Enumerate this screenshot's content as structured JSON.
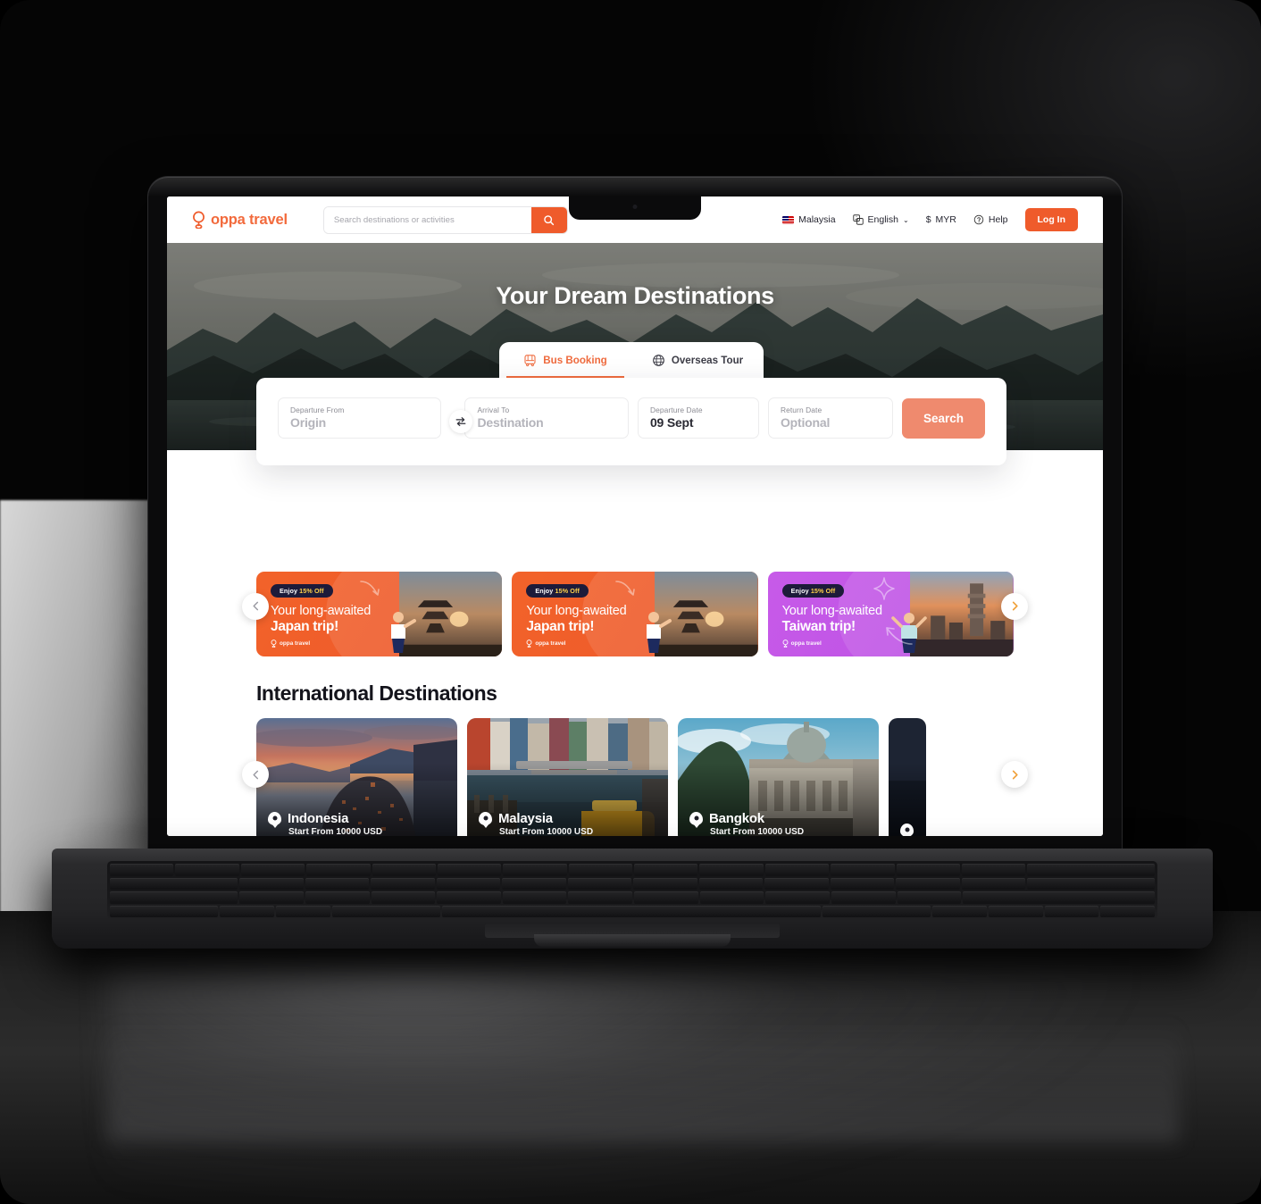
{
  "header": {
    "logo_text": "oppa travel",
    "logo_icon": "balloon-pin-icon",
    "search_placeholder": "Search destinations or activities",
    "search_value": "",
    "search_icon": "search-icon",
    "country": "Malaysia",
    "language": "English",
    "language_caret": "⌄",
    "currency": "MYR",
    "currency_symbol": "$",
    "help": "Help",
    "help_icon": "question-circle-icon",
    "login": "Log In"
  },
  "hero": {
    "title": "Your Dream Destinations"
  },
  "search_card": {
    "tabs": [
      {
        "label": "Bus Booking",
        "icon": "bus-icon",
        "active": true
      },
      {
        "label": "Overseas Tour",
        "icon": "globe-icon",
        "active": false
      }
    ],
    "fields": [
      {
        "name": "departure-from",
        "label": "Departure From",
        "value": "Origin",
        "is_placeholder": true
      },
      {
        "name": "arrival-to",
        "label": "Arrival To",
        "value": "Destination",
        "is_placeholder": true
      },
      {
        "name": "departure-date",
        "label": "Departure Date",
        "value": "09 Sept",
        "is_placeholder": false
      },
      {
        "name": "return-date",
        "label": "Return Date",
        "value": "Optional",
        "is_placeholder": true
      }
    ],
    "swap_icon": "swap-arrows-icon",
    "search_button": "Search"
  },
  "promos": [
    {
      "badge_prefix": "Enjoy ",
      "badge_value": "15% Off",
      "line1": "Your long-awaited",
      "line2": "Japan trip!",
      "brand": "oppa travel",
      "color": "#ef5b2b",
      "theme": "orange"
    },
    {
      "badge_prefix": "Enjoy ",
      "badge_value": "15% Off",
      "line1": "Your long-awaited",
      "line2": "Japan trip!",
      "brand": "oppa travel",
      "color": "#ef5b2b",
      "theme": "orange"
    },
    {
      "badge_prefix": "Enjoy ",
      "badge_value": "15% Off",
      "line1": "Your long-awaited",
      "line2": "Taiwan trip!",
      "brand": "oppa travel",
      "color": "#c055e6",
      "theme": "purple"
    }
  ],
  "carousel": {
    "prev_icon": "chevron-left-icon",
    "next_icon": "chevron-right-icon"
  },
  "section": {
    "title": "International Destinations"
  },
  "destinations": [
    {
      "name": "Indonesia",
      "subtitle": "Start From 10000 USD",
      "pin_icon": "location-pin-icon"
    },
    {
      "name": "Malaysia",
      "subtitle": "Start From 10000 USD",
      "pin_icon": "location-pin-icon"
    },
    {
      "name": "Bangkok",
      "subtitle": "Start From 10000 USD",
      "pin_icon": "location-pin-icon"
    }
  ],
  "colors": {
    "brand_orange": "#ef5b2b",
    "brand_orange_light": "#ef8a6e",
    "promo_purple": "#c055e6",
    "text_dark": "#14141c"
  }
}
